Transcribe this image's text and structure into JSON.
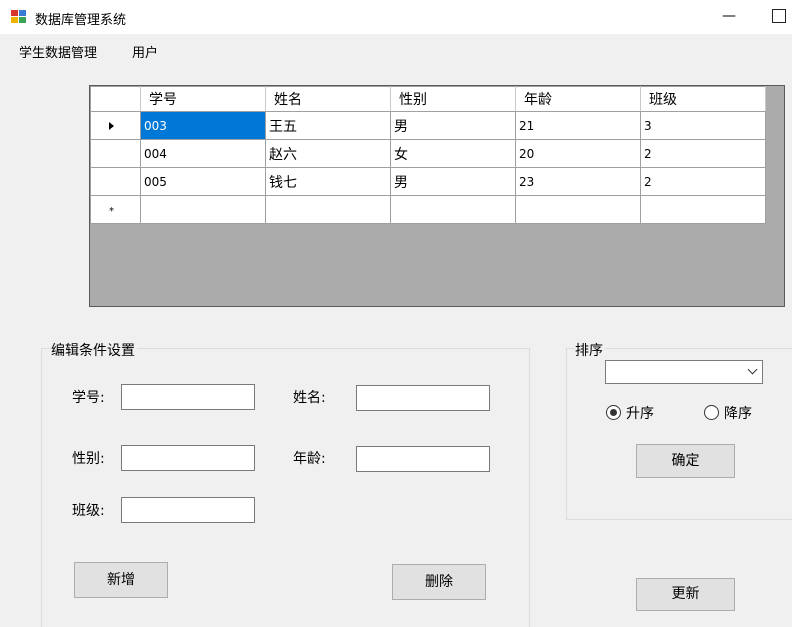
{
  "window": {
    "title": "数据库管理系统",
    "minimize_glyph": "—"
  },
  "menu": {
    "items": [
      {
        "label": "学生数据管理"
      },
      {
        "label": "用户"
      }
    ]
  },
  "grid": {
    "columns": [
      "学号",
      "姓名",
      "性别",
      "年龄",
      "班级"
    ],
    "rows": [
      [
        "003",
        "王五",
        "男",
        "21",
        "3"
      ],
      [
        "004",
        "赵六",
        "女",
        "20",
        "2"
      ],
      [
        "005",
        "钱七",
        "男",
        "23",
        "2"
      ]
    ],
    "selected_row": 0,
    "new_row_marker": "*"
  },
  "edit_group": {
    "title": "编辑条件设置",
    "fields": {
      "id_label": "学号:",
      "id_value": "",
      "name_label": "姓名:",
      "name_value": "",
      "gender_label": "性别:",
      "gender_value": "",
      "age_label": "年龄:",
      "age_value": "",
      "class_label": "班级:",
      "class_value": ""
    },
    "add_button": "新增",
    "delete_button": "删除"
  },
  "sort_group": {
    "title": "排序",
    "combo_value": "",
    "ascending_label": "升序",
    "descending_label": "降序",
    "ascending_selected": true,
    "confirm_button": "确定"
  },
  "update_button": "更新",
  "colors": {
    "selection": "#0078d7",
    "grid_background": "#ababab",
    "form_background": "#f0f0f0"
  }
}
